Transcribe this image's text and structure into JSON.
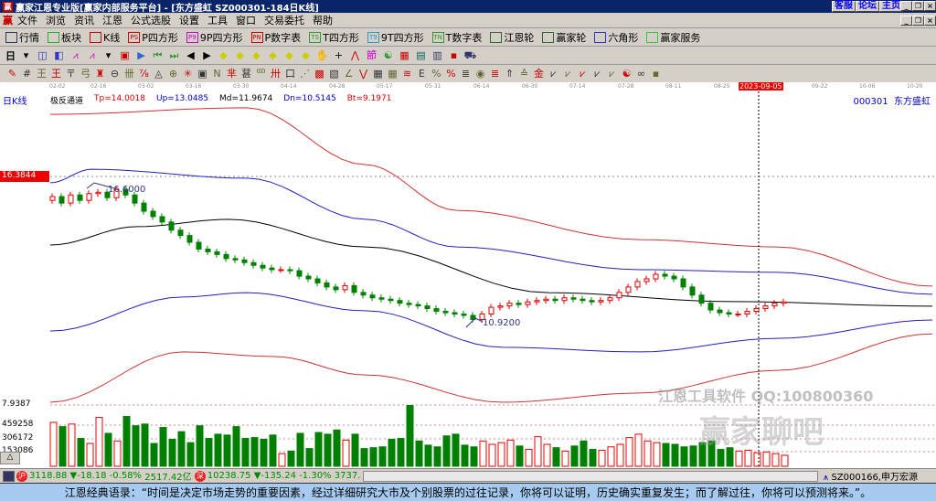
{
  "window": {
    "title": "赢家江恩专业版[赢家内部服务平台] - [东方盛虹   SZ000301-184日K线]",
    "buttons": [
      "客服",
      "论坛",
      "主页"
    ]
  },
  "menu": [
    "文件",
    "浏览",
    "资讯",
    "江恩",
    "公式选股",
    "设置",
    "工具",
    "窗口",
    "交易委托",
    "帮助"
  ],
  "toolbar1": [
    {
      "icon": "quotes-icon",
      "label": "行情",
      "c": "#336"
    },
    {
      "icon": "sector-icon",
      "label": "板块",
      "c": "#3a3"
    },
    {
      "icon": "kline-icon",
      "label": "K线",
      "c": "#c00"
    },
    {
      "icon": "p-square-icon",
      "label": "P四方形",
      "c": "#c00",
      "t": "PS"
    },
    {
      "icon": "9p-square-icon",
      "label": "9P四方形",
      "c": "#c0c",
      "t": "P9"
    },
    {
      "icon": "p-number-table-icon",
      "label": "P数字表",
      "c": "#c00",
      "t": "PN"
    },
    {
      "icon": "t-square-icon",
      "label": "T四方形",
      "c": "#393",
      "t": "TS"
    },
    {
      "icon": "9t-square-icon",
      "label": "9T四方形",
      "c": "#39c",
      "t": "T9"
    },
    {
      "icon": "t-number-table-icon",
      "label": "T数字表",
      "c": "#393",
      "t": "TN"
    },
    {
      "icon": "gann-wheel-icon",
      "label": "江恩轮",
      "c": "#363"
    },
    {
      "icon": "winner-wheel-icon",
      "label": "赢家轮",
      "c": "#363"
    },
    {
      "icon": "hexagon-icon",
      "label": "六角形",
      "c": "#33c"
    },
    {
      "icon": "dollar-icon",
      "label": "赢家服务",
      "c": "#3c3"
    }
  ],
  "toolbar2": {
    "period": "日",
    "icons": [
      "period-dropdown-icon",
      "chart-type-icon",
      "self-select-icon",
      "indicator-icon",
      "indicator2-icon",
      "candle-dropdown-icon",
      "rights-icon",
      "flag-icon",
      "first-bar-icon",
      "last-bar-icon",
      "scroll-left-icon",
      "scroll-right-icon",
      "zoom1-icon",
      "zoom2-icon",
      "zoom3-icon",
      "zoom4-icon",
      "zoom5-icon",
      "zoom6-icon",
      "hand-icon",
      "crosshair-icon",
      "line-icon",
      "node-icon",
      "analysis-icon",
      "calendar-icon",
      "calculator-icon",
      "note-icon",
      "save-icon",
      "truck-icon"
    ]
  },
  "toolbar3": {
    "icons": [
      "pen-icon",
      "grid-icon",
      "gann-tool1-icon",
      "gann-tool2-icon",
      "gann-tool3-icon",
      "gann-tool4-icon",
      "gann-tool5-icon",
      "circle-icon",
      "hash-icon",
      "grid-n2-icon",
      "triangle-icon",
      "target-icon",
      "star-icon",
      "box-icon",
      "line-n-icon",
      "fib-icon",
      "cycle-icon",
      "box2-icon",
      "span-icon",
      "rect-icon",
      "fan-icon",
      "square-icon",
      "square2-icon",
      "angle-icon",
      "wave-icon",
      "grid3-icon",
      "grid4-icon",
      "channel-icon",
      "tool-e-icon",
      "tool-f-icon",
      "percent-icon",
      "pct-line-icon",
      "gold-coin-icon",
      "gold-line-icon",
      "arrow-tool-icon",
      "gann-a-icon",
      "gold-icon",
      "line-up-icon",
      "line-f-icon",
      "line-g-icon",
      "line-h-icon",
      "line-i-icon",
      "line-j-icon",
      "yinyang-icon",
      "infinity-icon"
    ]
  },
  "date_axis": {
    "ticks": [
      "02-02",
      "02-16",
      "03-02",
      "03-16",
      "03-30",
      "04-14",
      "04-28",
      "05-17",
      "05-31",
      "06-14",
      "06-30",
      "07-14",
      "07-28",
      "08-11",
      "08-25",
      "09-22",
      "10-06",
      "10-20"
    ],
    "cursor_date": "2023-09-05"
  },
  "chart_header": {
    "period": "日K线",
    "indicator": "极反通道",
    "tp": "Tp=14.0018",
    "up": "Up=13.0485",
    "md": "Md=11.9674",
    "dn": "Dn=10.5145",
    "bt": "Bt=9.1971",
    "code": "000301",
    "name": "东方盛虹"
  },
  "colors": {
    "up": "#e00000",
    "down": "#008000",
    "upper_band": "#d03030",
    "inner_band": "#2020c0",
    "mid": "#000000",
    "cursor_label": "#e00000"
  },
  "chart_data": {
    "type": "candlestick",
    "price_axis": {
      "top_label": "16.3844",
      "bottom_label": "7.9387"
    },
    "annotations": {
      "high": "16.6000",
      "low": "10.9200"
    },
    "closes": [
      15.64,
      15.4,
      15.7,
      15.5,
      15.75,
      15.8,
      15.6,
      15.9,
      15.7,
      15.4,
      15.1,
      14.9,
      14.7,
      14.4,
      14.2,
      13.95,
      13.7,
      13.6,
      13.5,
      13.35,
      13.3,
      13.2,
      13.1,
      13.0,
      12.94,
      12.94,
      12.9,
      12.7,
      12.6,
      12.45,
      12.3,
      12.2,
      12.35,
      12.1,
      12.0,
      11.9,
      11.85,
      11.8,
      11.7,
      11.65,
      11.6,
      11.5,
      11.4,
      11.35,
      11.3,
      11.25,
      11.1,
      11.3,
      11.55,
      11.6,
      11.7,
      11.65,
      11.75,
      11.8,
      11.85,
      11.8,
      11.9,
      11.85,
      11.8,
      11.75,
      11.8,
      11.9,
      12.1,
      12.3,
      12.5,
      12.6,
      12.77,
      12.7,
      12.6,
      12.3,
      12.0,
      11.7,
      11.45,
      11.35,
      11.3,
      11.3,
      11.4,
      11.5,
      11.6,
      11.7,
      11.75
    ],
    "bands": {
      "tp": [
        [
          0,
          18.68
        ],
        [
          43,
          18.92
        ],
        [
          69,
          16.82
        ],
        [
          89,
          15.13
        ],
        [
          129,
          14.05
        ],
        [
          159,
          13.78
        ],
        [
          193,
          12.33
        ]
      ],
      "up": [
        [
          0,
          16.15
        ],
        [
          9,
          16.65
        ],
        [
          43,
          16.32
        ],
        [
          69,
          14.8
        ],
        [
          89,
          13.78
        ],
        [
          129,
          12.94
        ],
        [
          159,
          12.84
        ],
        [
          193,
          12.03
        ]
      ],
      "md": [
        [
          0,
          13.85
        ],
        [
          19,
          14.53
        ],
        [
          39,
          14.8
        ],
        [
          69,
          13.78
        ],
        [
          109,
          12.09
        ],
        [
          149,
          11.76
        ],
        [
          193,
          11.59
        ]
      ],
      "dn": [
        [
          0,
          10.67
        ],
        [
          29,
          11.93
        ],
        [
          43,
          12.09
        ],
        [
          69,
          11.42
        ],
        [
          99,
          10.07
        ],
        [
          129,
          9.9
        ],
        [
          159,
          10.4
        ],
        [
          193,
          11.08
        ]
      ],
      "bt": [
        [
          0,
          8.04
        ],
        [
          29,
          9.9
        ],
        [
          49,
          9.73
        ],
        [
          69,
          9.05
        ],
        [
          99,
          8.04
        ],
        [
          129,
          8.38
        ],
        [
          159,
          9.22
        ],
        [
          193,
          10.57
        ]
      ]
    },
    "volume_axis": {
      "labels": [
        "459258",
        "306172",
        "153086"
      ]
    },
    "volumes": [
      520000,
      470000,
      500000,
      330000,
      270000,
      580000,
      390000,
      300000,
      590000,
      480000,
      500000,
      270000,
      460000,
      320000,
      410000,
      280000,
      480000,
      330000,
      380000,
      370000,
      470000,
      330000,
      340000,
      320000,
      370000,
      150000,
      180000,
      390000,
      210000,
      400000,
      380000,
      430000,
      310000,
      380000,
      210000,
      220000,
      230000,
      320000,
      330000,
      720000,
      300000,
      250000,
      230000,
      360000,
      380000,
      250000,
      230000,
      300000,
      260000,
      280000,
      310000,
      240000,
      200000,
      350000,
      260000,
      220000,
      180000,
      240000,
      300000,
      200000,
      190000,
      230000,
      260000,
      340000,
      380000,
      300000,
      280000,
      270000,
      260000,
      230000,
      240000,
      280000,
      300000,
      200000,
      220000,
      180000,
      190000,
      160000,
      170000,
      150000,
      130000
    ]
  },
  "watermark": {
    "line1": "江恩工具软件  QQ:100800360",
    "line2": "赢家聊吧"
  },
  "status": {
    "sh_index": "3118.88",
    "sh_change": "▼-18.18",
    "sh_pct": "-0.58%",
    "sh_amount": "2517.42亿",
    "sz_index": "10238.75",
    "sz_change": "▼-135.24",
    "sz_pct": "-1.30%",
    "sz_amount": "3737.",
    "ticker": "SZ000166,申万宏源"
  },
  "quote": "江恩经典语录：“时间是决定市场走势的重要因素，经过详细研究大市及个别股票的过往记录，你将可以证明，历史确实重复发生；而了解过往，你将可以预测将来。”。"
}
